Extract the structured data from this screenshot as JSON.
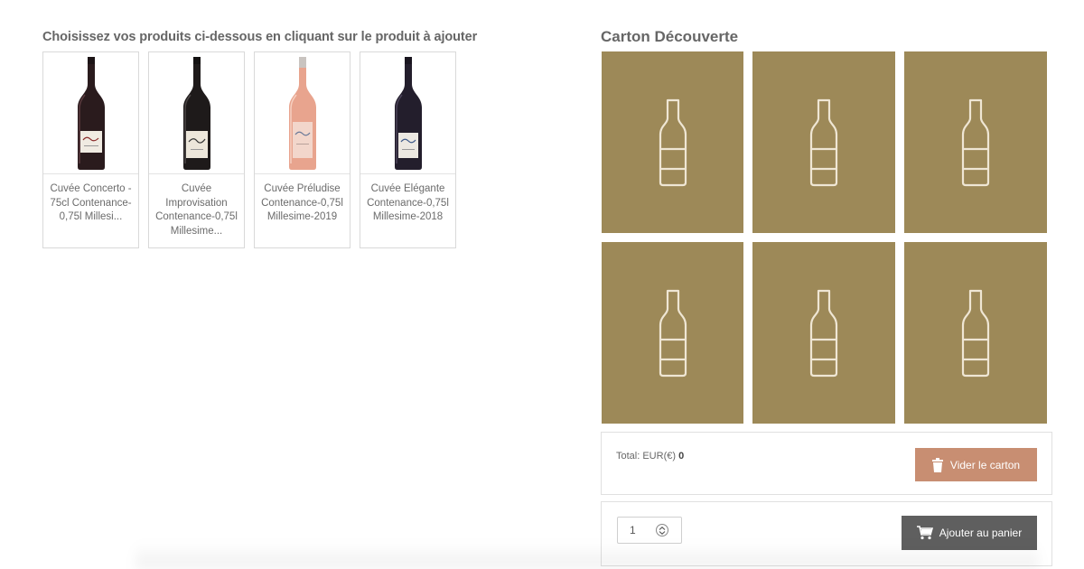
{
  "selector": {
    "title": "Choisissez vos produits ci-dessous en cliquant sur le produit à ajouter",
    "products": [
      {
        "name": "Cuvée Concerto - 75cl Contenance-0,75l Millesi...",
        "wine_color": "red"
      },
      {
        "name": "Cuvée Improvisation Contenance-0,75l Millesime...",
        "wine_color": "red"
      },
      {
        "name": "Cuvée Préludise Contenance-0,75l Millesime-2019",
        "wine_color": "rosé"
      },
      {
        "name": "Cuvée Elégante Contenance-0,75l Millesime-2018",
        "wine_color": "red"
      }
    ]
  },
  "box": {
    "title": "Carton Découverte",
    "slot_count": 6,
    "slot_icon": "wine-bottle-icon",
    "slot_color": "#9d8958"
  },
  "summary": {
    "total_label": "Total: EUR(€)",
    "total_value": "0",
    "empty_button": "Vider le carton",
    "empty_button_icon": "trash-icon",
    "empty_button_color": "#c88e72"
  },
  "cart": {
    "quantity": "1",
    "add_button": "Ajouter au panier",
    "add_button_icon": "cart-icon",
    "add_button_color": "#5f5f5f"
  }
}
